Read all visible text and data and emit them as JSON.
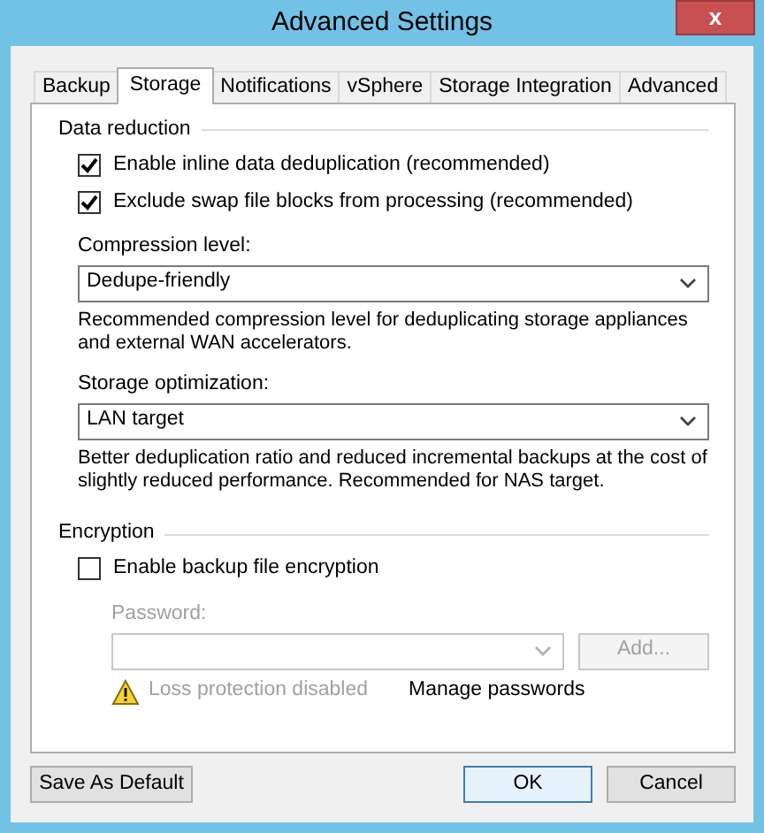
{
  "window": {
    "title": "Advanced Settings",
    "close": "x"
  },
  "tabs": [
    {
      "label": "Backup",
      "selected": false
    },
    {
      "label": "Storage",
      "selected": true
    },
    {
      "label": "Notifications",
      "selected": false
    },
    {
      "label": "vSphere",
      "selected": false
    },
    {
      "label": "Storage Integration",
      "selected": false
    },
    {
      "label": "Advanced",
      "selected": false
    }
  ],
  "data_reduction": {
    "heading": "Data reduction",
    "options": [
      {
        "label": "Enable inline data deduplication (recommended)",
        "checked": true
      },
      {
        "label": "Exclude swap file blocks from processing (recommended)",
        "checked": true
      }
    ],
    "compression": {
      "label": "Compression level:",
      "value": "Dedupe-friendly",
      "hint": "Recommended compression level for deduplicating storage appliances and external WAN accelerators."
    },
    "optimization": {
      "label": "Storage optimization:",
      "value": "LAN target",
      "hint": "Better deduplication ratio and reduced incremental backups at the cost of slightly reduced performance. Recommended for NAS target."
    }
  },
  "encryption": {
    "heading": "Encryption",
    "option": {
      "label": "Enable backup file encryption",
      "checked": false
    },
    "password_label": "Password:",
    "add_button": "Add...",
    "disabled": true,
    "warning": "Loss protection disabled",
    "manage_link": "Manage passwords"
  },
  "buttons": [
    {
      "label": "Save As Default",
      "kind": "left",
      "default": false
    },
    {
      "label": "OK",
      "kind": "right",
      "default": true
    },
    {
      "label": "Cancel",
      "kind": "right",
      "default": false
    }
  ]
}
